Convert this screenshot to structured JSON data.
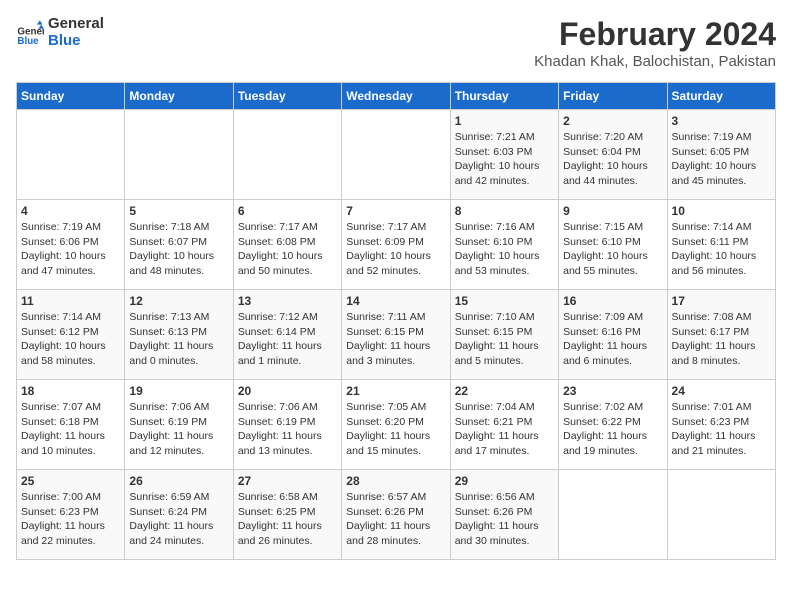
{
  "logo": {
    "line1": "General",
    "line2": "Blue"
  },
  "title": "February 2024",
  "subtitle": "Khadan Khak, Balochistan, Pakistan",
  "headers": [
    "Sunday",
    "Monday",
    "Tuesday",
    "Wednesday",
    "Thursday",
    "Friday",
    "Saturday"
  ],
  "weeks": [
    [
      {
        "num": "",
        "info": ""
      },
      {
        "num": "",
        "info": ""
      },
      {
        "num": "",
        "info": ""
      },
      {
        "num": "",
        "info": ""
      },
      {
        "num": "1",
        "info": "Sunrise: 7:21 AM\nSunset: 6:03 PM\nDaylight: 10 hours\nand 42 minutes."
      },
      {
        "num": "2",
        "info": "Sunrise: 7:20 AM\nSunset: 6:04 PM\nDaylight: 10 hours\nand 44 minutes."
      },
      {
        "num": "3",
        "info": "Sunrise: 7:19 AM\nSunset: 6:05 PM\nDaylight: 10 hours\nand 45 minutes."
      }
    ],
    [
      {
        "num": "4",
        "info": "Sunrise: 7:19 AM\nSunset: 6:06 PM\nDaylight: 10 hours\nand 47 minutes."
      },
      {
        "num": "5",
        "info": "Sunrise: 7:18 AM\nSunset: 6:07 PM\nDaylight: 10 hours\nand 48 minutes."
      },
      {
        "num": "6",
        "info": "Sunrise: 7:17 AM\nSunset: 6:08 PM\nDaylight: 10 hours\nand 50 minutes."
      },
      {
        "num": "7",
        "info": "Sunrise: 7:17 AM\nSunset: 6:09 PM\nDaylight: 10 hours\nand 52 minutes."
      },
      {
        "num": "8",
        "info": "Sunrise: 7:16 AM\nSunset: 6:10 PM\nDaylight: 10 hours\nand 53 minutes."
      },
      {
        "num": "9",
        "info": "Sunrise: 7:15 AM\nSunset: 6:10 PM\nDaylight: 10 hours\nand 55 minutes."
      },
      {
        "num": "10",
        "info": "Sunrise: 7:14 AM\nSunset: 6:11 PM\nDaylight: 10 hours\nand 56 minutes."
      }
    ],
    [
      {
        "num": "11",
        "info": "Sunrise: 7:14 AM\nSunset: 6:12 PM\nDaylight: 10 hours\nand 58 minutes."
      },
      {
        "num": "12",
        "info": "Sunrise: 7:13 AM\nSunset: 6:13 PM\nDaylight: 11 hours\nand 0 minutes."
      },
      {
        "num": "13",
        "info": "Sunrise: 7:12 AM\nSunset: 6:14 PM\nDaylight: 11 hours\nand 1 minute."
      },
      {
        "num": "14",
        "info": "Sunrise: 7:11 AM\nSunset: 6:15 PM\nDaylight: 11 hours\nand 3 minutes."
      },
      {
        "num": "15",
        "info": "Sunrise: 7:10 AM\nSunset: 6:15 PM\nDaylight: 11 hours\nand 5 minutes."
      },
      {
        "num": "16",
        "info": "Sunrise: 7:09 AM\nSunset: 6:16 PM\nDaylight: 11 hours\nand 6 minutes."
      },
      {
        "num": "17",
        "info": "Sunrise: 7:08 AM\nSunset: 6:17 PM\nDaylight: 11 hours\nand 8 minutes."
      }
    ],
    [
      {
        "num": "18",
        "info": "Sunrise: 7:07 AM\nSunset: 6:18 PM\nDaylight: 11 hours\nand 10 minutes."
      },
      {
        "num": "19",
        "info": "Sunrise: 7:06 AM\nSunset: 6:19 PM\nDaylight: 11 hours\nand 12 minutes."
      },
      {
        "num": "20",
        "info": "Sunrise: 7:06 AM\nSunset: 6:19 PM\nDaylight: 11 hours\nand 13 minutes."
      },
      {
        "num": "21",
        "info": "Sunrise: 7:05 AM\nSunset: 6:20 PM\nDaylight: 11 hours\nand 15 minutes."
      },
      {
        "num": "22",
        "info": "Sunrise: 7:04 AM\nSunset: 6:21 PM\nDaylight: 11 hours\nand 17 minutes."
      },
      {
        "num": "23",
        "info": "Sunrise: 7:02 AM\nSunset: 6:22 PM\nDaylight: 11 hours\nand 19 minutes."
      },
      {
        "num": "24",
        "info": "Sunrise: 7:01 AM\nSunset: 6:23 PM\nDaylight: 11 hours\nand 21 minutes."
      }
    ],
    [
      {
        "num": "25",
        "info": "Sunrise: 7:00 AM\nSunset: 6:23 PM\nDaylight: 11 hours\nand 22 minutes."
      },
      {
        "num": "26",
        "info": "Sunrise: 6:59 AM\nSunset: 6:24 PM\nDaylight: 11 hours\nand 24 minutes."
      },
      {
        "num": "27",
        "info": "Sunrise: 6:58 AM\nSunset: 6:25 PM\nDaylight: 11 hours\nand 26 minutes."
      },
      {
        "num": "28",
        "info": "Sunrise: 6:57 AM\nSunset: 6:26 PM\nDaylight: 11 hours\nand 28 minutes."
      },
      {
        "num": "29",
        "info": "Sunrise: 6:56 AM\nSunset: 6:26 PM\nDaylight: 11 hours\nand 30 minutes."
      },
      {
        "num": "",
        "info": ""
      },
      {
        "num": "",
        "info": ""
      }
    ]
  ]
}
